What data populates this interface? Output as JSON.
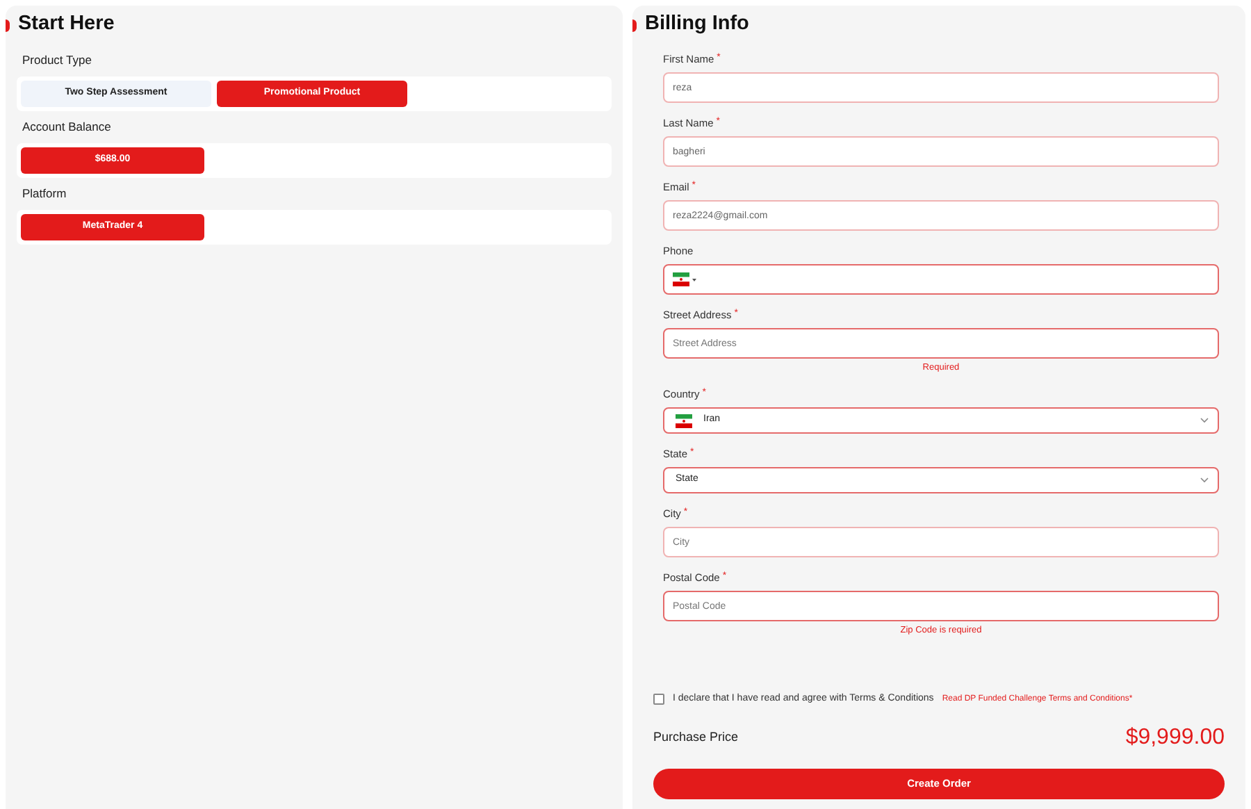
{
  "start": {
    "title": "Start Here",
    "groups": [
      {
        "label": "Product Type",
        "options": [
          {
            "label": "Two Step Assessment",
            "selected": false
          },
          {
            "label": "Promotional Product",
            "selected": true
          }
        ]
      },
      {
        "label": "Account Balance",
        "options": [
          {
            "label": "$688.00",
            "selected": true
          }
        ]
      },
      {
        "label": "Platform",
        "options": [
          {
            "label": "MetaTrader 4",
            "selected": true
          }
        ]
      }
    ]
  },
  "billing": {
    "title": "Billing Info",
    "fields": [
      {
        "kind": "text",
        "label": "First Name",
        "required_mark": "*",
        "value": "reza",
        "invalid": false
      },
      {
        "kind": "text",
        "label": "Last Name",
        "required_mark": "*",
        "value": "bagheri",
        "invalid": false
      },
      {
        "kind": "text",
        "label": "Email",
        "required_mark": "*",
        "value": "reza2224@gmail.com",
        "invalid": false
      },
      {
        "kind": "phone",
        "label": "Phone",
        "invalid": true
      },
      {
        "kind": "text",
        "label": "Street Address",
        "required_mark": "*",
        "placeholder": "Street Address",
        "invalid": true,
        "error": "Required"
      },
      {
        "kind": "select",
        "label": "Country",
        "required_mark": "*",
        "value": "Iran",
        "flag": true,
        "invalid": true
      },
      {
        "kind": "select",
        "label": "State",
        "required_mark": "*",
        "value": "State",
        "flag": false,
        "invalid": true
      },
      {
        "kind": "text",
        "label": "City",
        "required_mark": "*",
        "placeholder": "City",
        "invalid": false
      },
      {
        "kind": "text",
        "label": "Postal Code",
        "required_mark": "*",
        "placeholder": "Postal Code",
        "invalid": true,
        "error": "Zip Code is required"
      }
    ],
    "agree": {
      "checked": false,
      "label": "I declare that I have read and agree with Terms & Conditions",
      "link": "Read DP Funded Challenge Terms and Conditions*"
    },
    "price_label": "Purchase Price",
    "price": "$9,999.00",
    "submit": "Create Order"
  }
}
